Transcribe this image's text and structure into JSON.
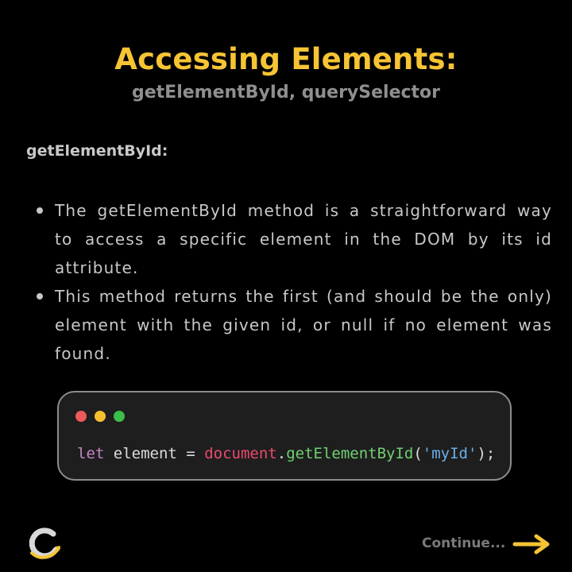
{
  "header": {
    "title": "Accessing Elements:",
    "subtitle": "getElementById, querySelector"
  },
  "section": {
    "heading": "getElementById:",
    "bullets": [
      "The getElementById method is a straightforward way to access a specific element in the DOM by its id attribute.",
      "This method returns the first (and should be the only) element with the given id, or null if no element was found."
    ]
  },
  "code": {
    "window_dots": [
      "red",
      "yellow",
      "green"
    ],
    "tokens": {
      "keyword": "let",
      "variable": "element",
      "assign": "=",
      "object": "document",
      "dot": ".",
      "method": "getElementById",
      "open": "(",
      "string": "'myId'",
      "close": ");"
    }
  },
  "footer": {
    "logo_icon": "logo-c-icon",
    "continue_label": "Continue...",
    "arrow_icon": "arrow-right-icon"
  },
  "colors": {
    "background": "#000000",
    "accent": "#f6c434",
    "code_background": "#1e1e1f"
  }
}
